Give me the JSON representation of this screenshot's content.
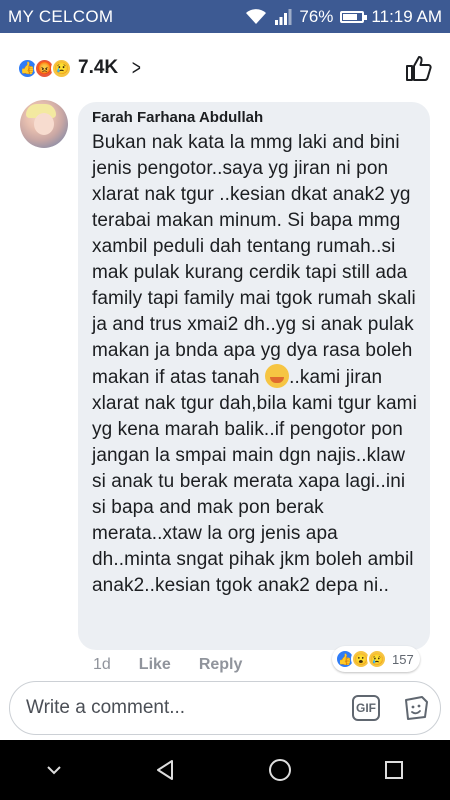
{
  "status_bar": {
    "carrier": "MY CELCOM",
    "battery_percent": "76%",
    "battery_level": 0.76,
    "time": "11:19 AM"
  },
  "reactions": {
    "icons": [
      "like-icon",
      "angry-icon",
      "sad-icon"
    ],
    "count": "7.4K"
  },
  "comment": {
    "author": "Farah Farhana Abdullah",
    "text_part1": "Bukan nak kata la mmg laki and bini jenis pengotor..saya yg jiran ni pon xlarat nak tgur ..kesian dkat anak2 yg terabai makan minum. Si bapa mmg xambil peduli dah tentang rumah..si mak pulak kurang cerdik tapi still ada family tapi family mai tgok rumah skali ja and trus xmai2 dh..yg si anak pulak makan ja bnda apa yg dya rasa boleh makan if atas tanah ",
    "inline_emoji": "vomiting-face-emoji",
    "text_part2": "..kami jiran xlarat nak tgur dah,bila kami tgur kami yg kena marah balik..if pengotor pon jangan la smpai main dgn najis..klaw si anak tu berak merata xapa lagi..ini si bapa and mak pon berak merata..xtaw la org jenis apa dh..minta sngat pihak jkm boleh ambil anak2..kesian tgok anak2 depa ni..",
    "time": "1d",
    "like_label": "Like",
    "reply_label": "Reply",
    "reaction_icons": [
      "like-icon",
      "wow-icon",
      "sad-icon"
    ],
    "reaction_count": "157"
  },
  "composer": {
    "placeholder": "Write a comment...",
    "gif_label": "GIF"
  },
  "colors": {
    "status_bar": "#3d5a93",
    "bubble": "#eceff3",
    "like_blue": "#2f7cf6"
  }
}
